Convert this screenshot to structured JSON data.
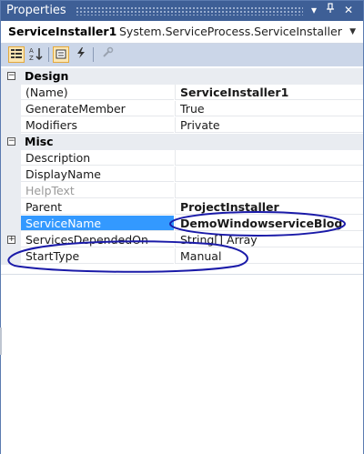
{
  "window": {
    "title": "Properties"
  },
  "selector": {
    "object_name": "ServiceInstaller1",
    "object_type": "System.ServiceProcess.ServiceInstaller"
  },
  "toolbar": {
    "buttons": [
      "categorized-icon",
      "alphabetical-icon",
      "properties-icon",
      "events-icon",
      "property-pages-icon"
    ]
  },
  "categories": [
    {
      "label": "Design",
      "rows": [
        {
          "name": "(Name)",
          "value": "ServiceInstaller1"
        },
        {
          "name": "GenerateMember",
          "value": "True"
        },
        {
          "name": "Modifiers",
          "value": "Private"
        }
      ]
    },
    {
      "label": "Misc",
      "rows": [
        {
          "name": "Description",
          "value": ""
        },
        {
          "name": "DisplayName",
          "value": ""
        },
        {
          "name": "HelpText",
          "value": ""
        },
        {
          "name": "Parent",
          "value": "ProjectInstaller"
        },
        {
          "name": "ServiceName",
          "value": "DemoWindowserviceBlog"
        },
        {
          "name": "ServicesDependedOn",
          "value": "String[] Array"
        },
        {
          "name": "StartType",
          "value": "Manual"
        }
      ]
    }
  ],
  "colors": {
    "titlebar": "#3e5f96",
    "toolbar": "#cbd6e8",
    "selection": "#3399ff",
    "annotation": "#1a1aa8"
  }
}
